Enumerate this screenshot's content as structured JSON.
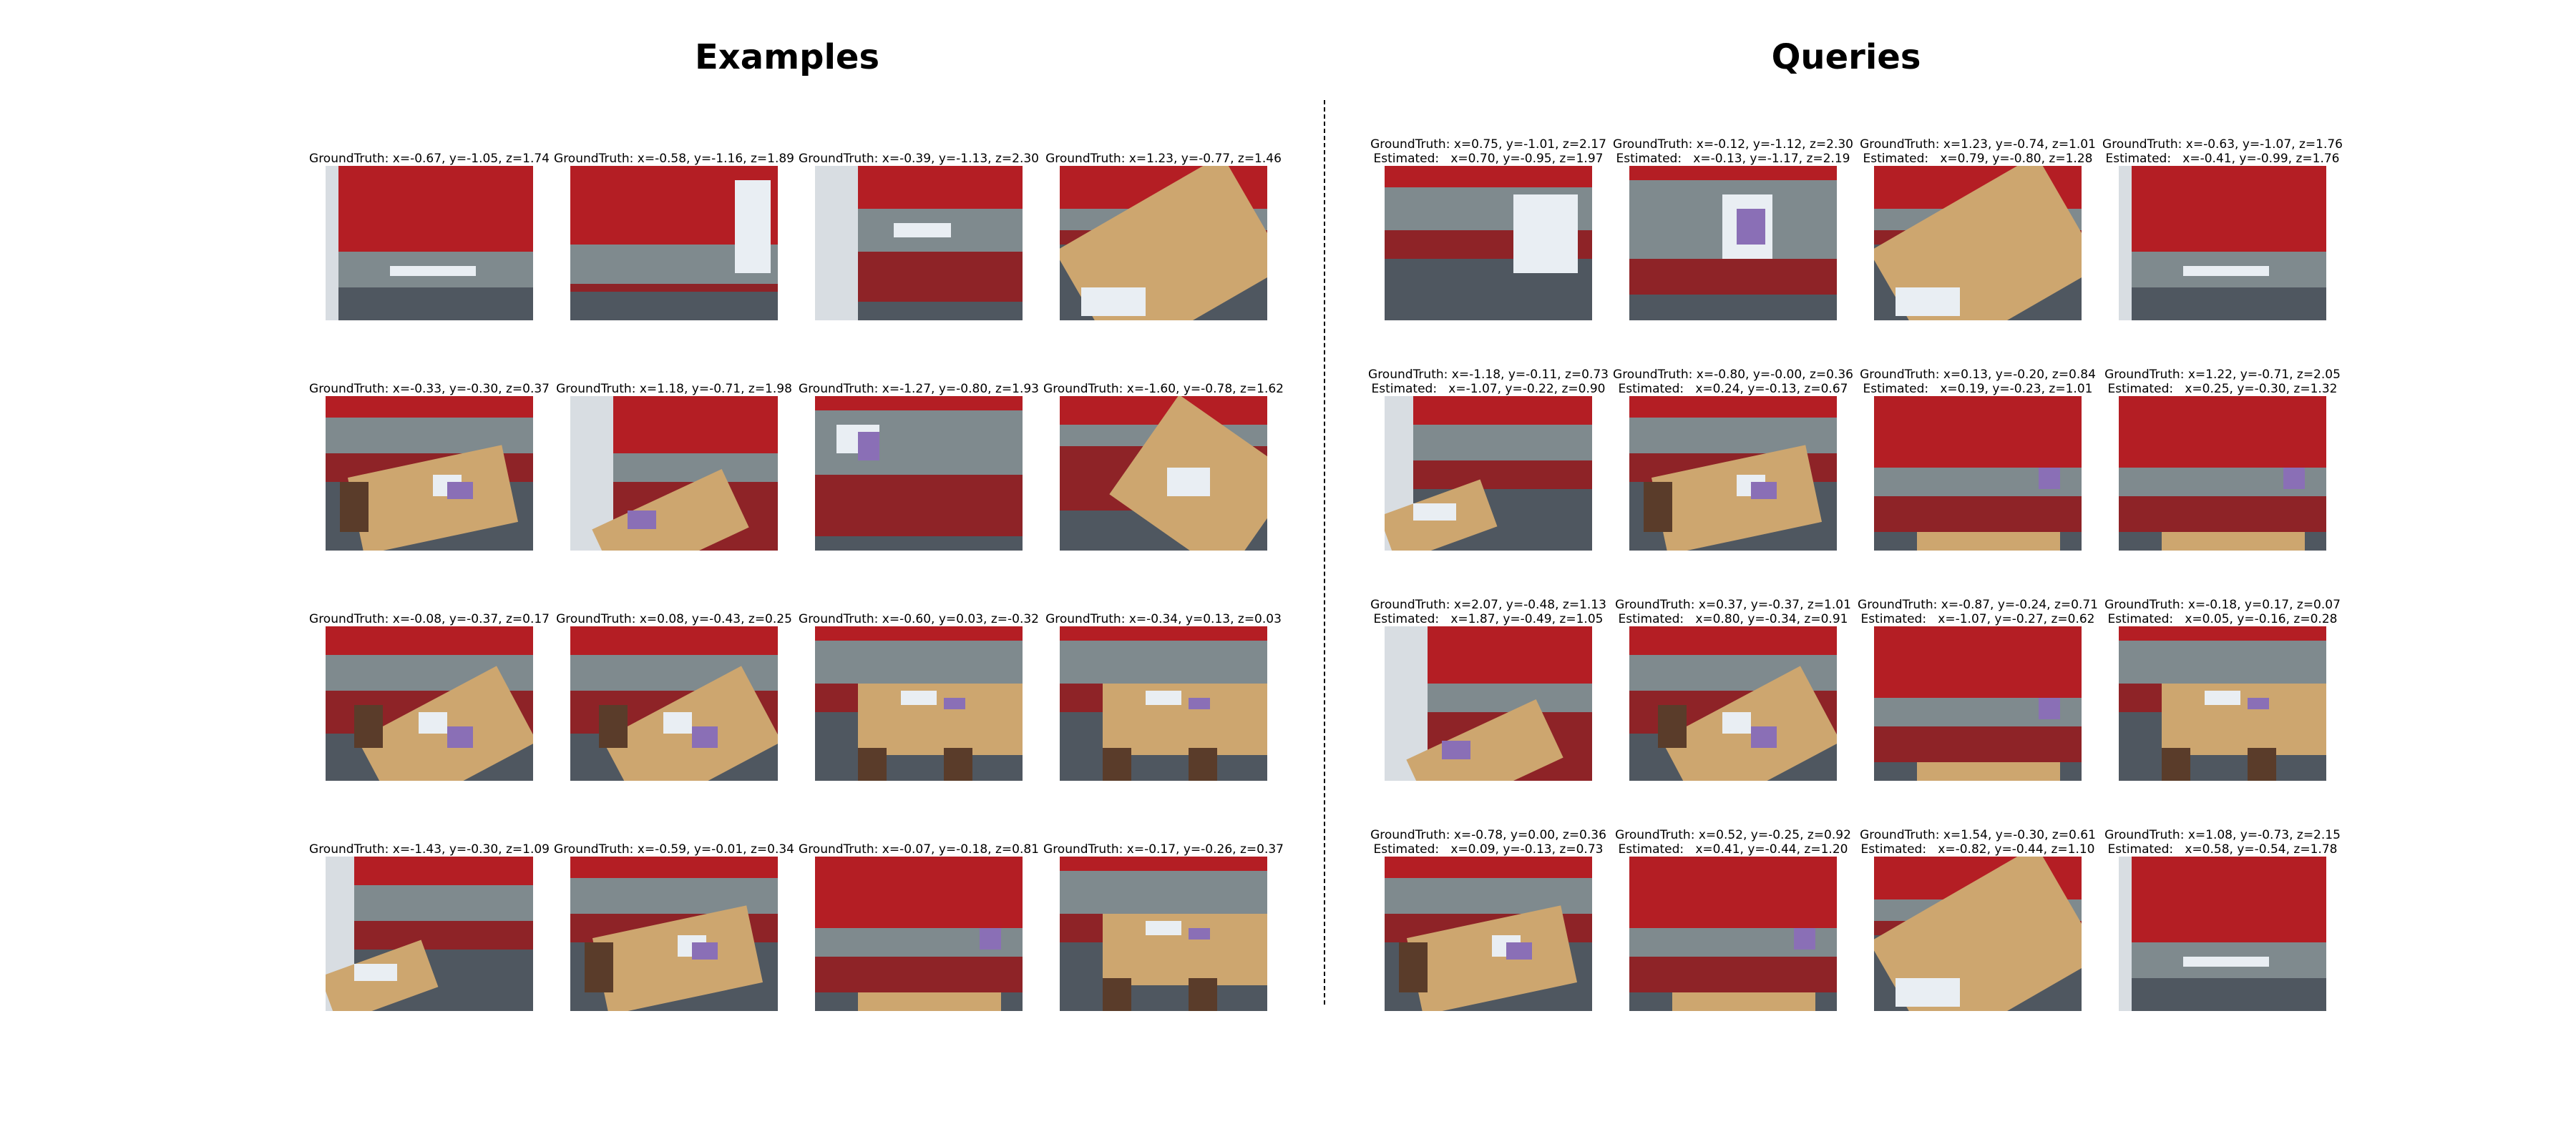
{
  "titles": {
    "examples": "Examples",
    "queries": "Queries"
  },
  "labels": {
    "gt": "GroundTruth:",
    "est": "Estimated:"
  },
  "examples": [
    [
      {
        "gt": "x=-0.67, y=-1.05, z=1.74",
        "v": 0
      },
      {
        "gt": "x=-0.58, y=-1.16, z=1.89",
        "v": 1
      },
      {
        "gt": "x=-0.39, y=-1.13, z=2.30",
        "v": 2
      },
      {
        "gt": "x=1.23, y=-0.77, z=1.46",
        "v": 3
      }
    ],
    [
      {
        "gt": "x=-0.33, y=-0.30, z=0.37",
        "v": 4
      },
      {
        "gt": "x=1.18, y=-0.71, z=1.98",
        "v": 5
      },
      {
        "gt": "x=-1.27, y=-0.80, z=1.93",
        "v": 6
      },
      {
        "gt": "x=-1.60, y=-0.78, z=1.62",
        "v": 7
      }
    ],
    [
      {
        "gt": "x=-0.08, y=-0.37, z=0.17",
        "v": 8
      },
      {
        "gt": "x=0.08, y=-0.43, z=0.25",
        "v": 8
      },
      {
        "gt": "x=-0.60, y=0.03, z=-0.32",
        "v": 9
      },
      {
        "gt": "x=-0.34, y=0.13, z=0.03",
        "v": 9
      }
    ],
    [
      {
        "gt": "x=-1.43, y=-0.30, z=1.09",
        "v": 10
      },
      {
        "gt": "x=-0.59, y=-0.01, z=0.34",
        "v": 4
      },
      {
        "gt": "x=-0.07, y=-0.18, z=0.81",
        "v": 11
      },
      {
        "gt": "x=-0.17, y=-0.26, z=0.37",
        "v": 9
      }
    ]
  ],
  "queries": [
    [
      {
        "gt": "x=0.75, y=-1.01, z=2.17",
        "est": "x=0.70, y=-0.95, z=1.97",
        "v": 12
      },
      {
        "gt": "x=-0.12, y=-1.12, z=2.30",
        "est": "x=-0.13, y=-1.17, z=2.19",
        "v": 13
      },
      {
        "gt": "x=1.23, y=-0.74, z=1.01",
        "est": "x=0.79, y=-0.80, z=1.28",
        "v": 3
      },
      {
        "gt": "x=-0.63, y=-1.07, z=1.76",
        "est": "x=-0.41, y=-0.99, z=1.76",
        "v": 0
      }
    ],
    [
      {
        "gt": "x=-1.18, y=-0.11, z=0.73",
        "est": "x=-1.07, y=-0.22, z=0.90",
        "v": 10
      },
      {
        "gt": "x=-0.80, y=-0.00, z=0.36",
        "est": "x=0.24, y=-0.13, z=0.67",
        "v": 4
      },
      {
        "gt": "x=0.13, y=-0.20, z=0.84",
        "est": "x=0.19, y=-0.23, z=1.01",
        "v": 11
      },
      {
        "gt": "x=1.22, y=-0.71, z=2.05",
        "est": "x=0.25, y=-0.30, z=1.32",
        "v": 11
      }
    ],
    [
      {
        "gt": "x=2.07, y=-0.48, z=1.13",
        "est": "x=1.87, y=-0.49, z=1.05",
        "v": 5
      },
      {
        "gt": "x=0.37, y=-0.37, z=1.01",
        "est": "x=0.80, y=-0.34, z=0.91",
        "v": 8
      },
      {
        "gt": "x=-0.87, y=-0.24, z=0.71",
        "est": "x=-1.07, y=-0.27, z=0.62",
        "v": 11
      },
      {
        "gt": "x=-0.18, y=0.17, z=0.07",
        "est": "x=0.05, y=-0.16, z=0.28",
        "v": 9
      }
    ],
    [
      {
        "gt": "x=-0.78, y=0.00, z=0.36",
        "est": "x=0.09, y=-0.13, z=0.73",
        "v": 4
      },
      {
        "gt": "x=0.52, y=-0.25, z=0.92",
        "est": "x=0.41, y=-0.44, z=1.20",
        "v": 11
      },
      {
        "gt": "x=1.54, y=-0.30, z=0.61",
        "est": "x=-0.82, y=-0.44, z=1.10",
        "v": 3
      },
      {
        "gt": "x=1.08, y=-0.73, z=2.15",
        "est": "x=0.58, y=-0.54, z=1.78",
        "v": 0
      }
    ]
  ]
}
